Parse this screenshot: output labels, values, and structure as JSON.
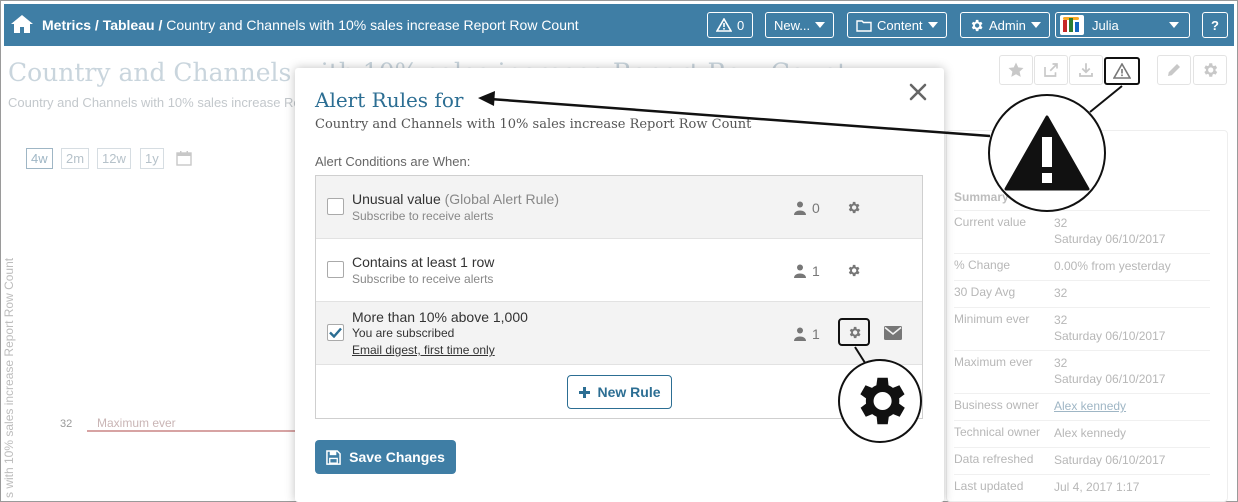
{
  "topbar": {
    "breadcrumb_part1": "Metrics / Tableau /",
    "breadcrumb_part2": "Country and Channels with 10% sales increase Report Row Count",
    "alerts_count": "0",
    "new_label": "New...",
    "content_label": "Content",
    "admin_label": "Admin",
    "user_name": "Julia",
    "help_label": "?"
  },
  "page": {
    "title": "Country and Channels with 10% sales increase Report Row Count",
    "subtitle": "Country and Channels with 10% sales increase Report Row Count",
    "range_tabs": [
      "4w",
      "2m",
      "12w",
      "1y"
    ],
    "y_axis_label": "s with 10% sales increase Report Row Count",
    "tick_value": "32",
    "max_line_label": "Maximum ever"
  },
  "summary": {
    "heading": "Summary",
    "rows": [
      {
        "key": "Current value",
        "value": "32",
        "value2": "Saturday 06/10/2017"
      },
      {
        "key": "% Change",
        "value": "0.00% from yesterday",
        "value2": ""
      },
      {
        "key": "30 Day Avg",
        "value": "32",
        "value2": ""
      },
      {
        "key": "Minimum ever",
        "value": "32",
        "value2": "Saturday 06/10/2017"
      },
      {
        "key": "Maximum ever",
        "value": "32",
        "value2": "Saturday 06/10/2017"
      },
      {
        "key": "Business owner",
        "value": "Alex kennedy",
        "value2": ""
      },
      {
        "key": "Technical owner",
        "value": "Alex kennedy",
        "value2": ""
      },
      {
        "key": "Data refreshed",
        "value": "Saturday 06/10/2017",
        "value2": ""
      },
      {
        "key": "Last updated",
        "value": "Jul 4, 2017 1:17",
        "value2": ""
      }
    ]
  },
  "modal": {
    "title": "Alert Rules for",
    "subtitle": "Country and Channels with 10% sales increase Report Row Count",
    "conditions_label": "Alert Conditions are When:",
    "rules": [
      {
        "title": "Unusual value",
        "global": "(Global Alert Rule)",
        "sub": "Subscribe to receive alerts",
        "count": "0",
        "checked": false
      },
      {
        "title": "Contains at least 1 row",
        "global": "",
        "sub": "Subscribe to receive alerts",
        "count": "1",
        "checked": false
      },
      {
        "title": "More than 10% above 1,000",
        "global": "",
        "sub": "You are subscribed",
        "digest": "Email digest, first time only",
        "count": "1",
        "checked": true
      }
    ],
    "new_rule_label": "New Rule",
    "save_label": "Save Changes"
  },
  "colors": {
    "primary": "#3f7ea5",
    "title_blue": "#2c6e93"
  }
}
